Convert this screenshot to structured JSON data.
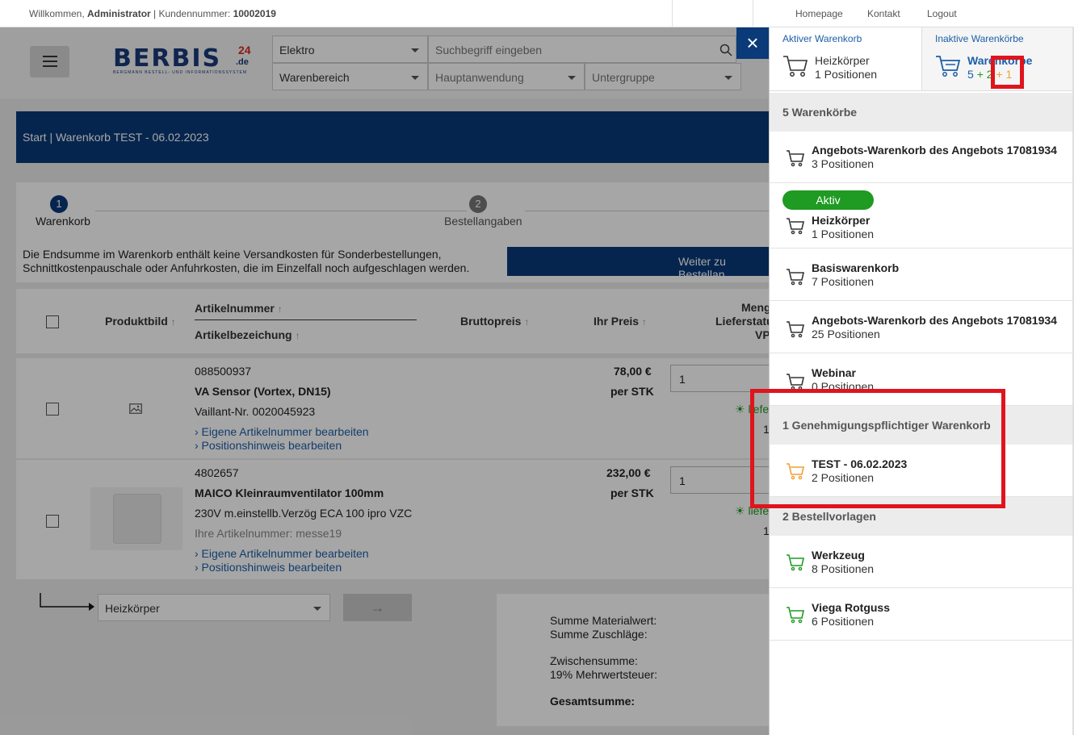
{
  "topbar": {
    "welcome": "Willkommen,",
    "user": "Administrator",
    "customer_label": "| Kundennummer:",
    "customer_no": "10002019",
    "homepage": "Homepage",
    "contact": "Kontakt",
    "logout": "Logout"
  },
  "header": {
    "logo_main": "BERBIS",
    "logo_24": "24",
    "logo_de": ".de",
    "logo_sub": "BERGMANN BESTELL- UND INFORMATIONSSYSTEM",
    "cat1": "Elektro",
    "search_placeholder": "Suchbegriff eingeben",
    "cat2": "Warenbereich",
    "cat3": "Hauptanwendung",
    "cat4": "Untergruppe"
  },
  "breadcrumb": {
    "text": "Start | Warenkorb TEST - 06.02.2023"
  },
  "steps": {
    "s1_num": "1",
    "s1_label": "Warenkorb",
    "s2_num": "2",
    "s2_label": "Bestellangaben",
    "note_line1": "Die Endsumme im Warenkorb enthält keine Versandkosten für Sonderbestellungen,",
    "note_line2": "Schnittkostenpauschale oder Anfuhrkosten, die im Einzelfall noch aufgeschlagen werden.",
    "continue": "Weiter zu Bestellan"
  },
  "table": {
    "col_image": "Produktbild",
    "col_artnr": "Artikelnummer",
    "col_artbez": "Artikelbezeichung",
    "col_brutto": "Bruttopreis",
    "col_price": "Ihr Preis",
    "col_qty": "Meng",
    "col_status": "Lieferstatu",
    "col_vp": "VP"
  },
  "rows": [
    {
      "artnr": "088500937",
      "name": "VA Sensor (Vortex, DN15)",
      "desc": "Vaillant-Nr. 0020045923",
      "own_nr": "",
      "link1": "› Eigene Artikelnummer bearbeiten",
      "link2": "› Positionshinweis bearbeiten",
      "price": "78,00 €",
      "unit": "per STK",
      "qty": "1",
      "status": "liefer",
      "vp": "1"
    },
    {
      "artnr": "4802657",
      "name": "MAICO Kleinraumventilator 100mm",
      "desc": "230V m.einstellb.Verzög ECA 100 ipro VZC",
      "own_nr": "Ihre Artikelnummer: messe19",
      "link1": "› Eigene Artikelnummer bearbeiten",
      "link2": "› Positionshinweis bearbeiten",
      "price": "232,00 €",
      "unit": "per STK",
      "qty": "1",
      "status": "liefer",
      "vp": "1"
    }
  ],
  "footer": {
    "cart_select": "Heizkörper",
    "sum_material": "Summe Materialwert:",
    "sum_surcharge": "Summe Zuschläge:",
    "subtotal": "Zwischensumme:",
    "vat": "19% Mehrwertsteuer:",
    "total": "Gesamtsumme:"
  },
  "panel": {
    "close": "×",
    "active_tab": {
      "title": "Aktiver Warenkorb",
      "name": "Heizkörper",
      "positions": "1 Positionen"
    },
    "inactive_tab": {
      "title": "Inaktive Warenkörbe",
      "name": "Warenkörbe",
      "count_blue": "5",
      "count_green": "+ 2",
      "count_orange": "+ 1"
    },
    "section_carts": "5 Warenkörbe",
    "carts": [
      {
        "name": "Angebots-Warenkorb des Angebots 17081934",
        "positions": "3 Positionen"
      },
      {
        "name": "Heizkörper",
        "positions": "1 Positionen",
        "badge": "Aktiv"
      },
      {
        "name": "Basiswarenkorb",
        "positions": "7 Positionen"
      },
      {
        "name": "Angebots-Warenkorb des Angebots 17081934",
        "positions": "25 Positionen"
      },
      {
        "name": "Webinar",
        "positions": "0 Positionen"
      }
    ],
    "section_approval": "1 Genehmigungspflichtiger Warenkorb",
    "approval": [
      {
        "name": "TEST - 06.02.2023",
        "positions": "2 Positionen"
      }
    ],
    "section_templates": "2 Bestellvorlagen",
    "templates": [
      {
        "name": "Werkzeug",
        "positions": "8 Positionen"
      },
      {
        "name": "Viega Rotguss",
        "positions": "6 Positionen"
      }
    ]
  },
  "colors": {
    "navy": "#0a3a78",
    "link": "#1d5ea8",
    "green": "#1f9a22",
    "orange": "#f0a030",
    "highlight": "#e0141c"
  }
}
